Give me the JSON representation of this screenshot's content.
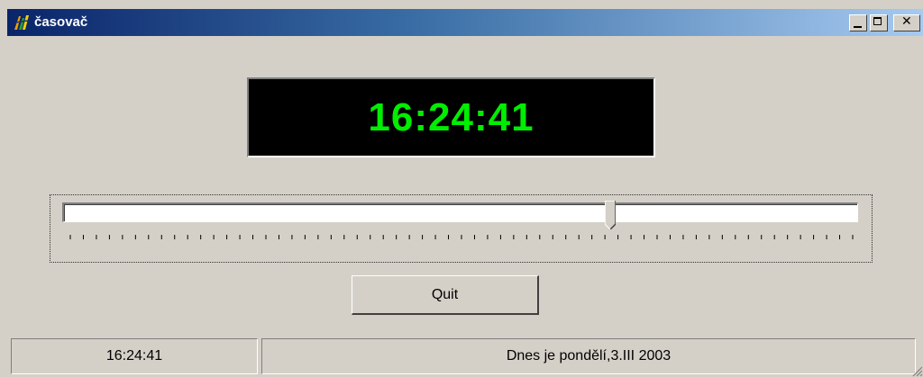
{
  "window": {
    "title": "časovač",
    "app_icon": "app-icon",
    "controls": [
      "minimize-icon",
      "maximize-icon",
      "close-icon"
    ]
  },
  "clock": {
    "time": "16:24:41",
    "color": "#00ee00",
    "background": "#000000"
  },
  "slider": {
    "position_fraction": 0.69,
    "tick_count": 61
  },
  "quit_button": {
    "label": "Quit"
  },
  "statusbar": {
    "time": "16:24:41",
    "date": "Dnes je pondělí,3.III 2003"
  },
  "colors": {
    "title_start": "#0a246a",
    "title_end": "#a6caf0",
    "face": "#d4d0c8"
  }
}
